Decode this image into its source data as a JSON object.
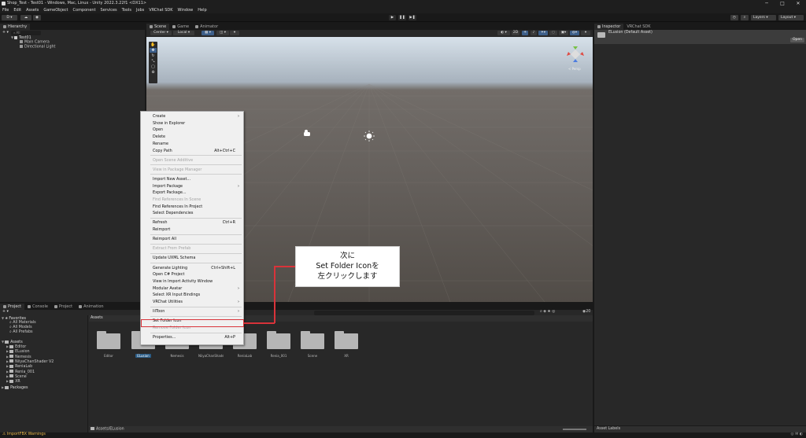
{
  "window": {
    "title": "Shop_Test - Test01 - Windows, Mac, Linux - Unity 2022.3.22f1 <DX11>",
    "controls": [
      "─",
      "□",
      "✕"
    ]
  },
  "menubar": [
    "File",
    "Edit",
    "Assets",
    "GameObject",
    "Component",
    "Services",
    "Tools",
    "Jobs",
    "VRChat SDK",
    "Window",
    "Help"
  ],
  "toolbar": {
    "account": "D",
    "layers": "Layers",
    "layout": "Layout",
    "play": "▶",
    "pause": "❚❚",
    "step": "▶❚"
  },
  "hierarchy": {
    "tab": "Hierarchy",
    "search_placeholder": "All",
    "scene": "Test01",
    "items": [
      "Main Camera",
      "Directional Light"
    ]
  },
  "scene_view": {
    "tabs": [
      "Scene",
      "Game",
      "Animator"
    ],
    "pivot": "Center",
    "space": "Local",
    "toolbar_2d": "2D",
    "persp_label": "< Persp"
  },
  "inspector": {
    "tabs": [
      "Inspector",
      "VRChat SDK"
    ],
    "asset_name": "ELusion (Default Asset)",
    "open_button": "Open",
    "asset_labels": "Asset Labels"
  },
  "project": {
    "tabs": [
      "Project",
      "Console",
      "Project",
      "Animation"
    ],
    "favorites_label": "Favorites",
    "favorites": [
      "All Materials",
      "All Models",
      "All Prefabs"
    ],
    "assets_label": "Assets",
    "asset_tree": [
      "Editor",
      "ELusion",
      "Nemesis",
      "NiiyaChanShader V2",
      "ReniaLab",
      "Renia_001",
      "Scene",
      "XR"
    ],
    "packages_label": "Packages",
    "breadcrumb": "Assets",
    "path": "Assets/ELusion",
    "count": "20",
    "folders": [
      "Editor",
      "ELusion",
      "Nemesis",
      "NiiyaChanShader...",
      "ReniaLab",
      "Renia_001",
      "Scene",
      "XR"
    ],
    "selected_folder": "ELusion"
  },
  "status": {
    "text": "ImportFBX Warnings"
  },
  "context_menu": {
    "items": [
      {
        "label": "Create",
        "arrow": true
      },
      {
        "label": "Show in Explorer"
      },
      {
        "label": "Open"
      },
      {
        "label": "Delete"
      },
      {
        "label": "Rename"
      },
      {
        "label": "Copy Path",
        "shortcut": "Alt+Ctrl+C"
      },
      {
        "sep": true
      },
      {
        "label": "Open Scene Additive",
        "disabled": true
      },
      {
        "sep": true
      },
      {
        "label": "View in Package Manager",
        "disabled": true
      },
      {
        "sep": true
      },
      {
        "label": "Import New Asset..."
      },
      {
        "label": "Import Package",
        "arrow": true
      },
      {
        "label": "Export Package..."
      },
      {
        "label": "Find References In Scene",
        "disabled": true
      },
      {
        "label": "Find References In Project"
      },
      {
        "label": "Select Dependencies"
      },
      {
        "sep": true
      },
      {
        "label": "Refresh",
        "shortcut": "Ctrl+R"
      },
      {
        "label": "Reimport"
      },
      {
        "sep": true
      },
      {
        "label": "Reimport All"
      },
      {
        "sep": true
      },
      {
        "label": "Extract From Prefab",
        "disabled": true
      },
      {
        "sep": true
      },
      {
        "label": "Update UXML Schema"
      },
      {
        "sep": true
      },
      {
        "label": "Generate Lighting",
        "shortcut": "Ctrl+Shift+L"
      },
      {
        "label": "Open C# Project"
      },
      {
        "label": "View in Import Activity Window"
      },
      {
        "label": "Modular Avatar",
        "arrow": true
      },
      {
        "label": "Select XR Input Bindings"
      },
      {
        "label": "VRChat Utilities",
        "arrow": true
      },
      {
        "sep": true
      },
      {
        "label": "lilToon",
        "arrow": true
      },
      {
        "sep": true
      },
      {
        "label": "Set Folder Icon"
      },
      {
        "label": "Remove Folder Icon",
        "disabled": true
      },
      {
        "sep": true
      },
      {
        "label": "Properties...",
        "shortcut": "Alt+P"
      }
    ]
  },
  "callout": {
    "line1": "次に",
    "line2": "Set Folder Iconを",
    "line3": "左クリックします"
  },
  "colors": {
    "highlight": "#d9333a",
    "panel": "#282828",
    "selected": "#2c5d87"
  }
}
